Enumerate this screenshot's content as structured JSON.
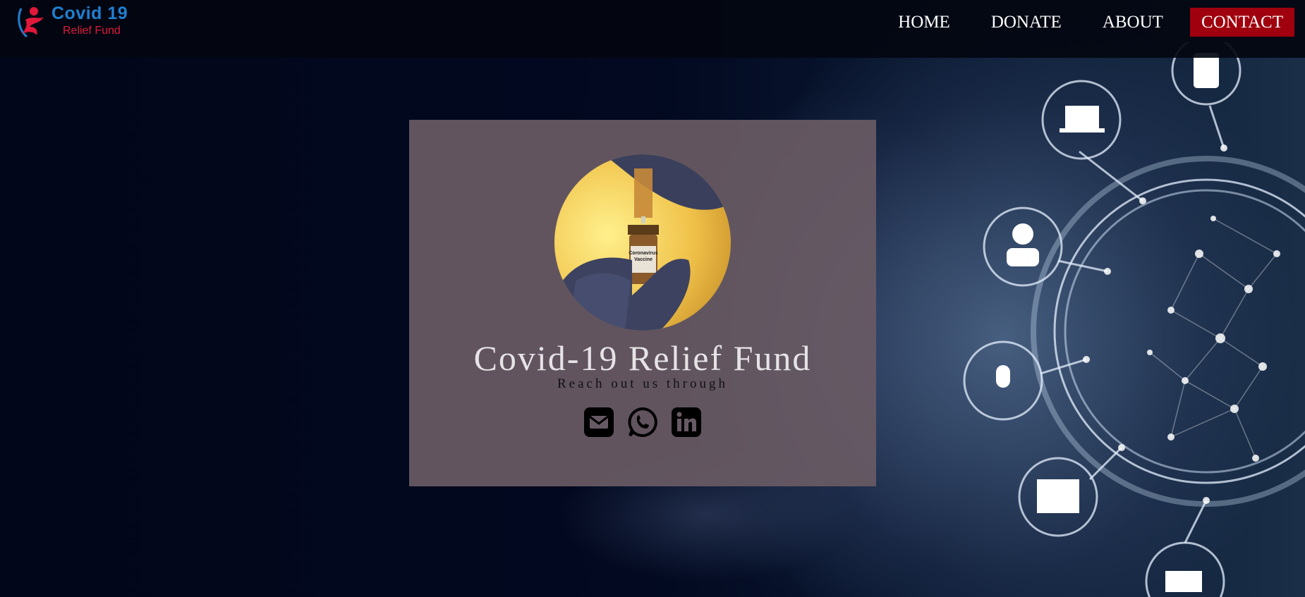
{
  "logo": {
    "title": "Covid 19",
    "subtitle": "Relief Fund"
  },
  "nav": {
    "items": [
      {
        "label": "HOME"
      },
      {
        "label": "DONATE"
      },
      {
        "label": "ABOUT"
      },
      {
        "label": "CONTACT"
      }
    ],
    "active": "CONTACT"
  },
  "card": {
    "title": "Covid-19 Relief Fund",
    "subtitle": "Reach out us through",
    "image_label": "Coronavirus Vaccine",
    "socials": [
      {
        "icon": "envelope-icon"
      },
      {
        "icon": "whatsapp-icon"
      },
      {
        "icon": "linkedin-icon"
      }
    ]
  },
  "colors": {
    "nav_active_bg": "#a0000d",
    "logo_blue": "#1f7fd0",
    "logo_red": "#e0183a",
    "card_bg": "#685a64"
  }
}
